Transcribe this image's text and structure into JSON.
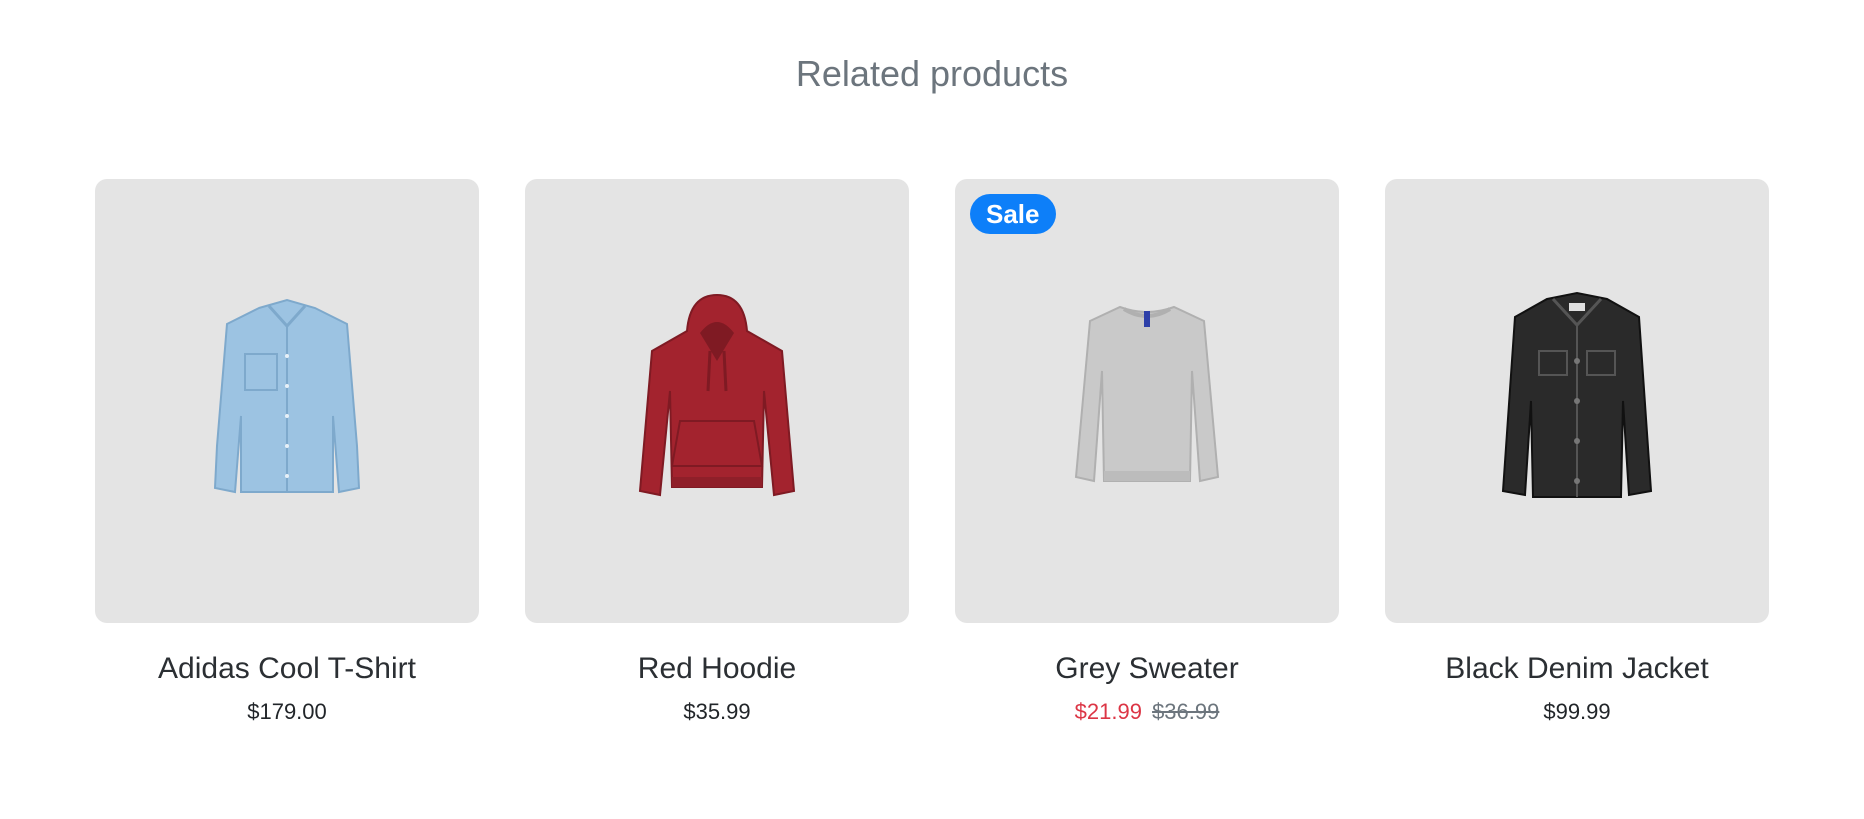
{
  "section": {
    "title": "Related products"
  },
  "products": [
    {
      "name": "Adidas Cool T-Shirt",
      "price": "$179.00",
      "image_icon": "denim-shirt-image",
      "color": "#9cc3e2"
    },
    {
      "name": "Red Hoodie",
      "price": "$35.99",
      "image_icon": "red-hoodie-image",
      "color": "#a3232e"
    },
    {
      "name": "Grey Sweater",
      "badge": "Sale",
      "sale_price": "$21.99",
      "original_price": "$36.99",
      "image_icon": "grey-sweater-image",
      "color": "#c9c9c9"
    },
    {
      "name": "Black Denim Jacket",
      "price": "$99.99",
      "image_icon": "black-denim-jacket-image",
      "color": "#2a2a2a"
    }
  ],
  "colors": {
    "badge": "#0d7ff9",
    "sale_price": "#dc3545",
    "card_background": "#e4e4e4"
  }
}
